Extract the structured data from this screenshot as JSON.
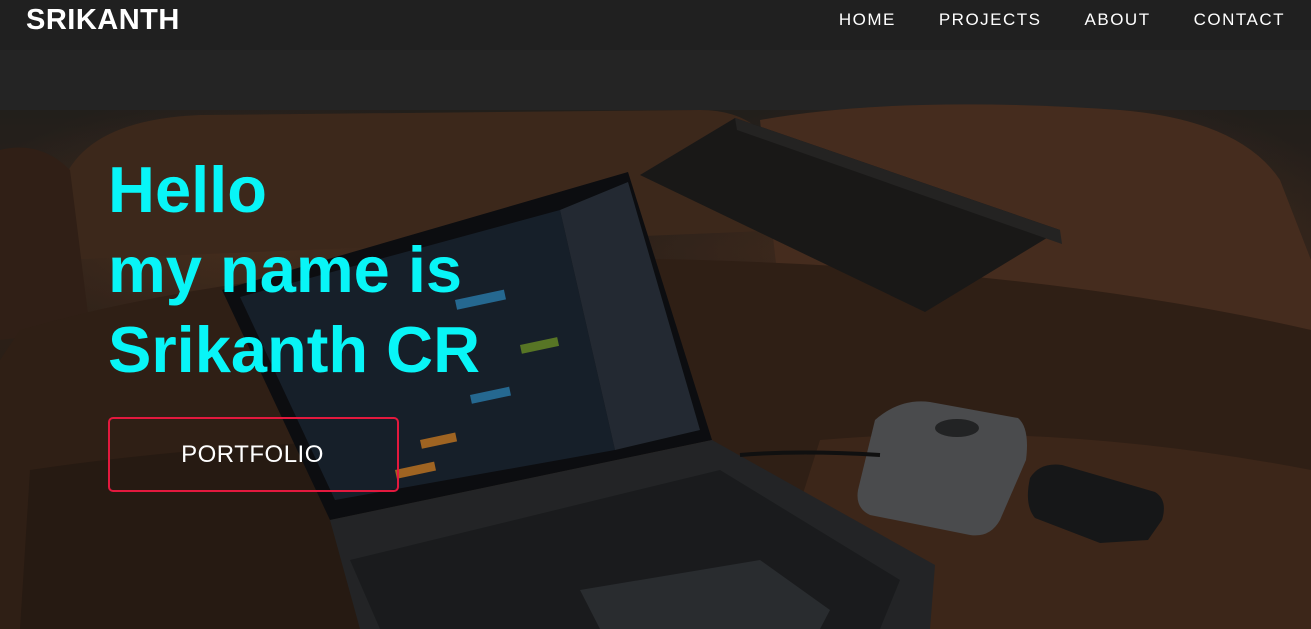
{
  "brand": {
    "name": "SRIKANTH"
  },
  "nav": {
    "items": [
      {
        "label": "HOME"
      },
      {
        "label": "PROJECTS"
      },
      {
        "label": "ABOUT"
      },
      {
        "label": "CONTACT"
      }
    ]
  },
  "hero": {
    "lines": [
      "Hello",
      "my name is",
      "Srikanth CR"
    ],
    "cta_label": "PORTFOLIO"
  },
  "colors": {
    "headline": "#08f5f7",
    "cta_border": "#e3193e",
    "nav_text": "#ffffff"
  }
}
